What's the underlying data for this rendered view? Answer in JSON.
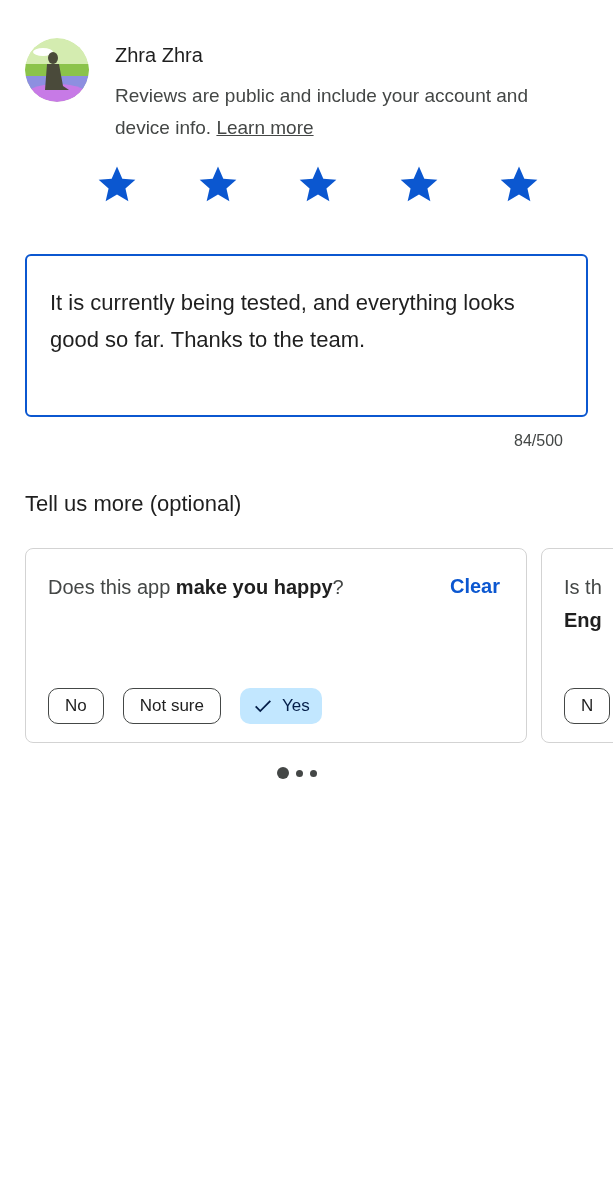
{
  "user": {
    "name": "Zhra Zhra"
  },
  "notice": {
    "text": "Reviews are public and include your account and device info.",
    "link": "Learn more"
  },
  "rating": {
    "stars": 5
  },
  "review": {
    "value": "It is currently being tested, and everything looks good so far. Thanks to the team.",
    "counter": "84/500"
  },
  "more": {
    "title": "Tell us more (optional)",
    "cards": [
      {
        "question": "Does this app **make you happy**?",
        "clear": "Clear",
        "options": [
          {
            "label": "No",
            "selected": false
          },
          {
            "label": "Not sure",
            "selected": false
          },
          {
            "label": "Yes",
            "selected": true
          }
        ]
      },
      {
        "question": "Is th\n**Eng**",
        "options": [
          {
            "label": "N",
            "selected": false
          }
        ]
      }
    ],
    "pager": [
      {
        "selected": true
      },
      {
        "selected": false
      },
      {
        "selected": false
      }
    ]
  }
}
